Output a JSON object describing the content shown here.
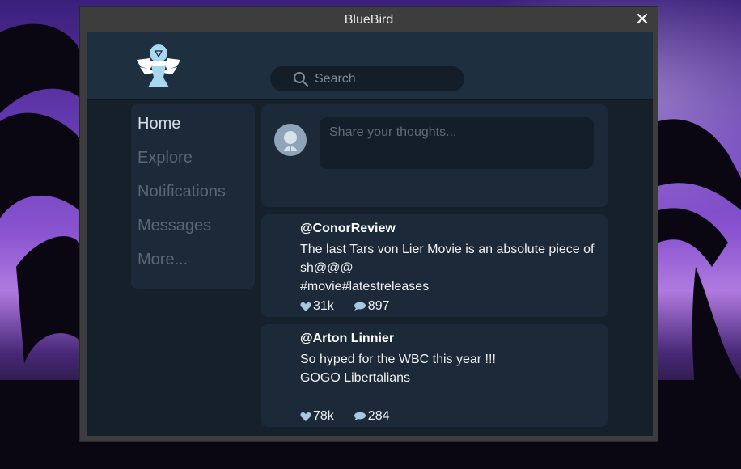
{
  "window": {
    "title": "BlueBird",
    "close_glyph": "✕"
  },
  "search": {
    "placeholder": "Search",
    "icon": "search-icon"
  },
  "nav": {
    "items": [
      {
        "label": "Home",
        "active": true
      },
      {
        "label": "Explore",
        "active": false
      },
      {
        "label": "Notifications",
        "active": false
      },
      {
        "label": "Messages",
        "active": false
      },
      {
        "label": "More...",
        "active": false
      }
    ]
  },
  "composer": {
    "placeholder": "Share your thoughts..."
  },
  "posts": [
    {
      "handle": "@ConorReview",
      "text": "The last Tars von Lier Movie is an absolute piece of sh@@@\n#movie#latestreleases",
      "likes": "31k",
      "comments": "897"
    },
    {
      "handle": "@Arton Linnier",
      "text": "So hyped for the WBC this year !!!\nGOGO Libertalians",
      "likes": "78k",
      "comments": "284"
    }
  ],
  "colors": {
    "accent": "#a8d8f0",
    "panel": "#1c2938",
    "background": "#15202b",
    "header": "#1e2f40"
  }
}
